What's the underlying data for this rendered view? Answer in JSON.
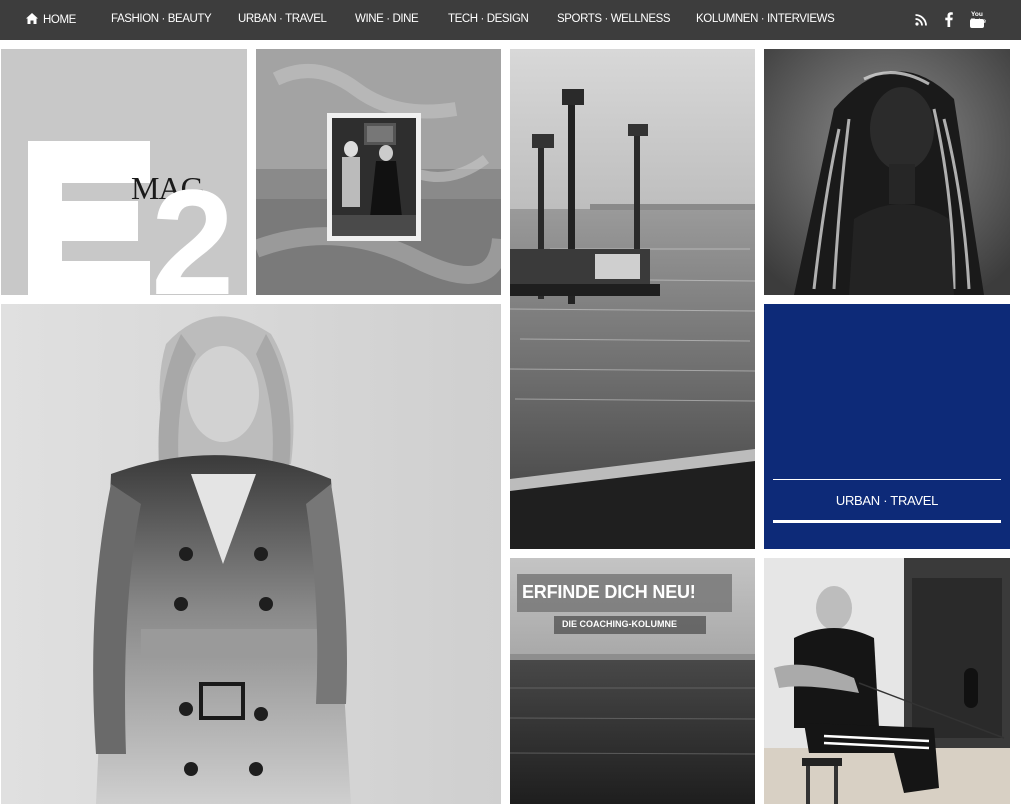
{
  "nav": {
    "items": [
      {
        "label": "HOME"
      },
      {
        "label": "FASHION · BEAUTY"
      },
      {
        "label": "URBAN · TRAVEL"
      },
      {
        "label": "WINE · DINE"
      },
      {
        "label": "TECH · DESIGN"
      },
      {
        "label": "SPORTS · WELLNESS"
      },
      {
        "label": "KOLUMNEN · INTERVIEWS"
      }
    ],
    "social": [
      "rss-icon",
      "facebook-icon",
      "youtube-icon"
    ],
    "youtube_text": "You Tube"
  },
  "logo": {
    "mag": "MAG",
    "two": "2"
  },
  "tiles": {
    "urban_label": "URBAN · TRAVEL",
    "coach_title": "ERFINDE DICH NEU!",
    "coach_sub": "DIE COACHING-KOLUMNE"
  },
  "colors": {
    "nav_bg": "#3d3d3d",
    "logo_bg": "#c8c8c8",
    "urban_blue": "#0d2a78"
  }
}
